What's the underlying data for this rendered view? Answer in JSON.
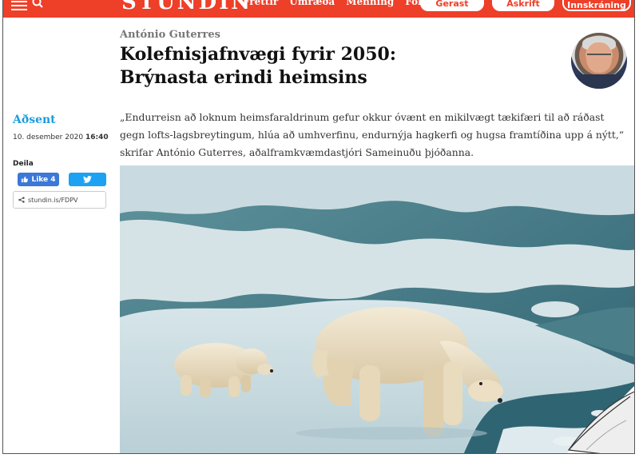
{
  "site": {
    "logo": "STUNDIN",
    "nav": [
      "Fréttir",
      "Umræða",
      "Menning",
      "Fólk"
    ],
    "buttons": [
      "Gerast áskrifandi",
      "Áskrift",
      "Innskráning"
    ]
  },
  "article": {
    "author": "António Guterres",
    "title_line1": "Kolefnisjafnvægi fyrir 2050:",
    "title_line2": "Brýnasta erindi heimsins",
    "lead": "„Endurreisn að loknum heimsfaraldrinum gefur okkur óvænt en mikilvægt tækifæri til að ráðast gegn lofts-lagsbreytingum, hlúa að umhverfinu, endurnýja hagkerfi og hugsa framtíðina upp á nýtt,“ skrifar António Guterres, aðalframkvæmdastjóri Sameinuðu þjóðanna."
  },
  "sidebar": {
    "category": "Aðsent",
    "date": "10. desember 2020",
    "time": "16:40",
    "share_label": "Deila",
    "like_label": "Like 4",
    "short_link": "stundin.is/FDPV"
  },
  "colors": {
    "brand_red": "#ee3f28",
    "category_blue": "#1b9be0",
    "facebook_blue": "#3b78d8",
    "twitter_blue": "#1da1f2"
  },
  "icons": [
    "menu-icon",
    "search-icon",
    "thumbs-up-icon",
    "twitter-bird-icon",
    "share-icon"
  ]
}
